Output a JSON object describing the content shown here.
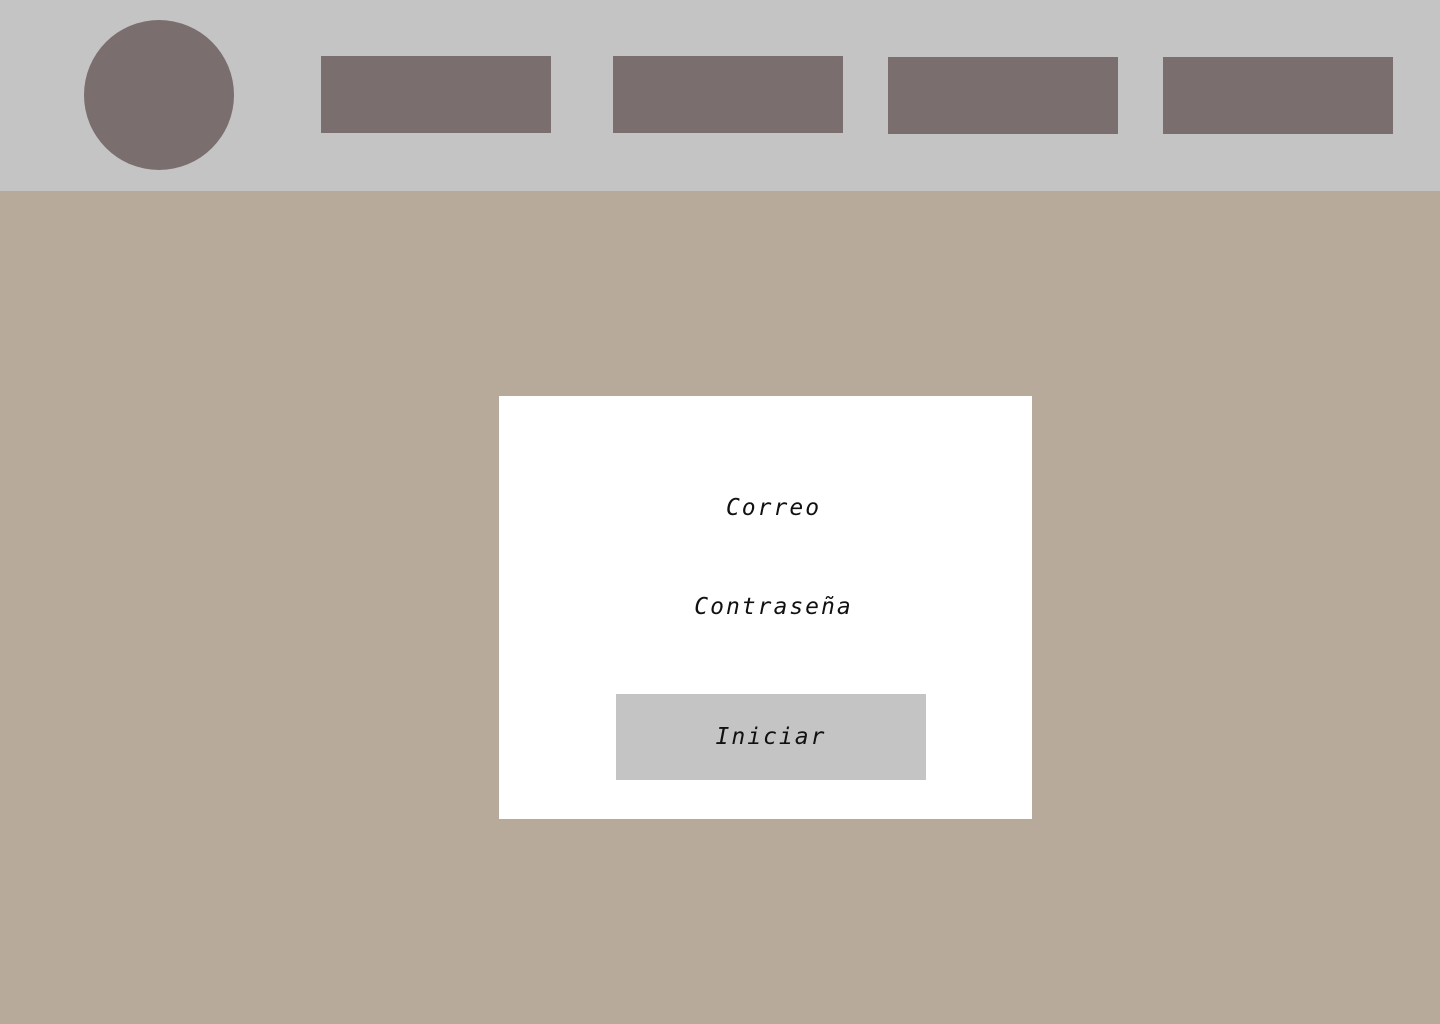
{
  "colors": {
    "page_background": "#B7AA9A",
    "header_background": "#C4C4C4",
    "placeholder_block": "#7A6E6E",
    "card_background": "#FFFFFF",
    "button_background": "#C4C4C4",
    "text": "#111111"
  },
  "header": {
    "logo": "logo-placeholder",
    "nav_items": [
      {
        "label": ""
      },
      {
        "label": ""
      },
      {
        "label": ""
      },
      {
        "label": ""
      }
    ]
  },
  "login": {
    "email_label": "Correo",
    "password_label": "Contraseña",
    "submit_label": "Iniciar"
  }
}
